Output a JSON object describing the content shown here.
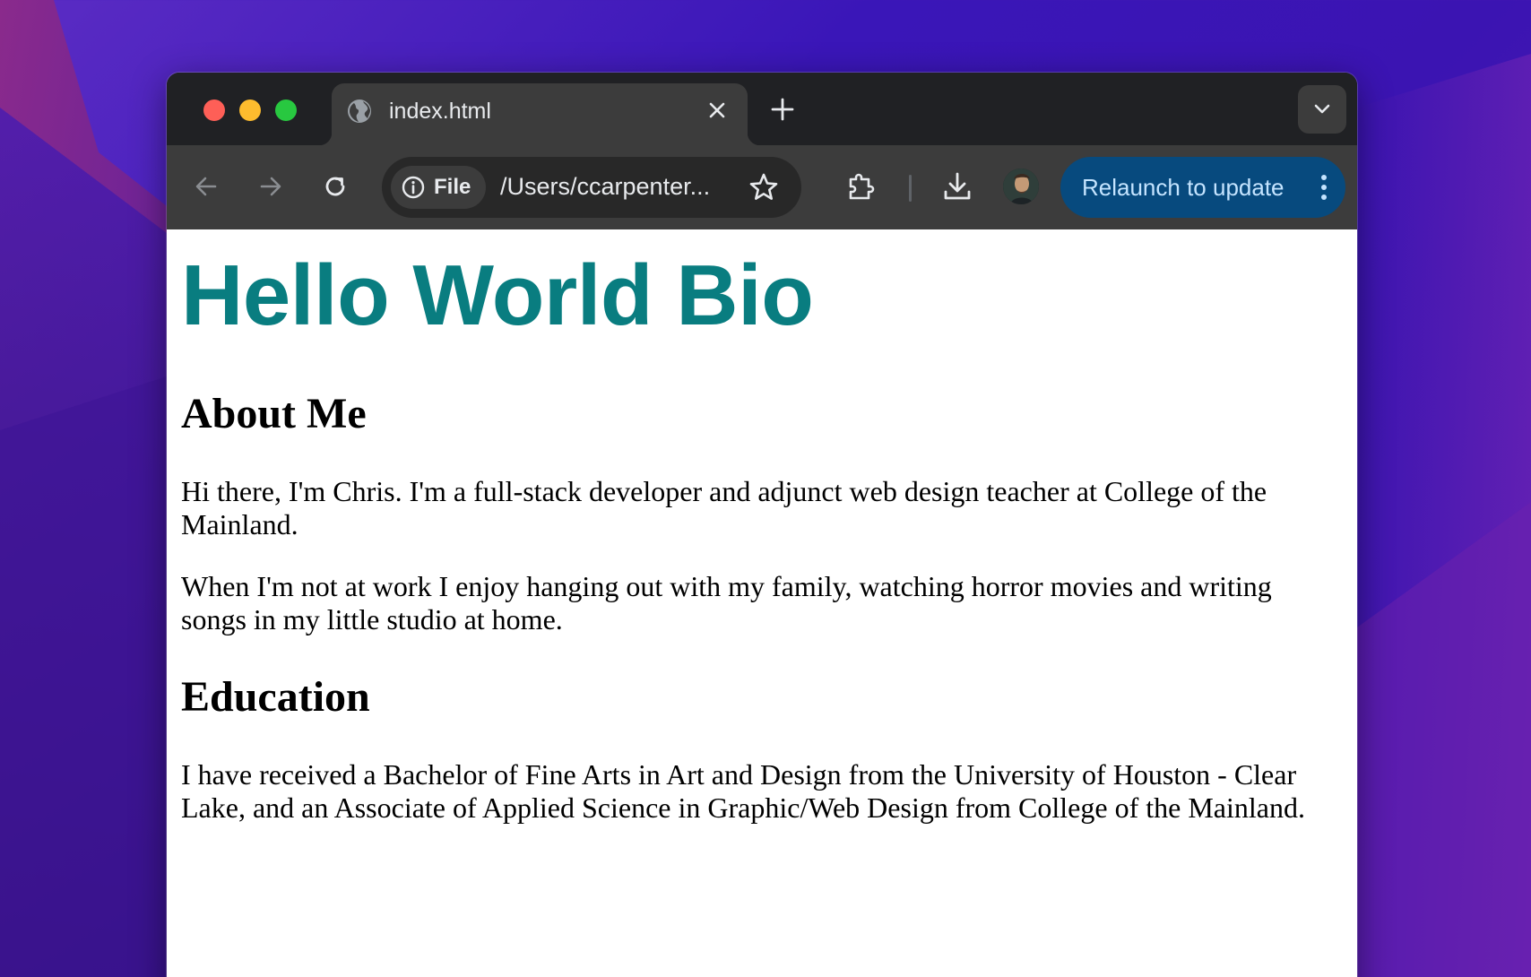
{
  "browser": {
    "tab": {
      "title": "index.html"
    },
    "omnibox": {
      "scheme_chip": "File",
      "url": "/Users/ccarpenter..."
    },
    "relaunch_label": "Relaunch to update"
  },
  "page": {
    "title": "Hello World Bio",
    "sections": [
      {
        "heading": "About Me",
        "paragraphs": [
          "Hi there, I'm Chris. I'm a full-stack developer and adjunct web design teacher at College of the Mainland.",
          "When I'm not at work I enjoy hanging out with my family, watching horror movies and writing songs in my little studio at home."
        ]
      },
      {
        "heading": "Education",
        "paragraphs": [
          "I have received a Bachelor of Fine Arts in Art and Design from the University of Houston - Clear Lake, and an Associate of Applied Science in Graphic/Web Design from College of the Mainland."
        ]
      }
    ]
  },
  "colors": {
    "heading_accent": "#097d80",
    "relaunch_bg": "#074a7e",
    "relaunch_text": "#c4e4ff",
    "traffic_close": "#fe5f57",
    "traffic_minimize": "#febc2e",
    "traffic_zoom": "#28c840"
  },
  "icons": {
    "tab_favicon": "globe-icon",
    "tab_close": "close-icon",
    "new_tab": "plus-icon",
    "tab_search": "chevron-down-icon",
    "back": "arrow-left-icon",
    "forward": "arrow-right-icon",
    "reload": "reload-icon",
    "site_info": "info-icon",
    "bookmark": "star-icon",
    "extensions": "puzzle-icon",
    "downloads": "download-icon",
    "relaunch_menu": "more-vertical-icon"
  }
}
